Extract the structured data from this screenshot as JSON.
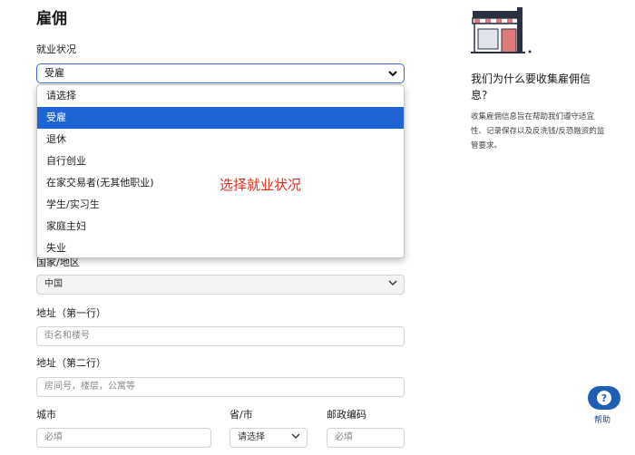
{
  "page": {
    "title": "雇佣"
  },
  "employment": {
    "label": "就业状况",
    "selected": "受雇",
    "options": [
      "请选择",
      "受雇",
      "退休",
      "自行创业",
      "在家交易者(无其他职业)",
      "学生/实习生",
      "家庭主妇",
      "失业"
    ],
    "selected_index": 1,
    "annotation": "选择就业状况"
  },
  "country": {
    "label": "国家/地区",
    "value": "中国"
  },
  "address1": {
    "label": "地址（第一行）",
    "placeholder": "街名和楼号"
  },
  "address2": {
    "label": "地址（第二行）",
    "placeholder": "房间号，楼层，公寓等"
  },
  "city": {
    "label": "城市",
    "placeholder": "必填"
  },
  "province": {
    "label": "省/市",
    "value": "请选择"
  },
  "postal": {
    "label": "邮政编码",
    "placeholder": "必填"
  },
  "sidebar": {
    "title": "我们为什么要收集雇佣信息?",
    "text": "收集雇佣信息旨在帮助我们遵守适宜性、记录保存以及反洗钱/反恐融资的监管要求。"
  },
  "help": {
    "label": "帮助"
  },
  "colors": {
    "accent": "#1e64d2",
    "annotation": "#e0301e",
    "help": "#1e5fb4"
  }
}
